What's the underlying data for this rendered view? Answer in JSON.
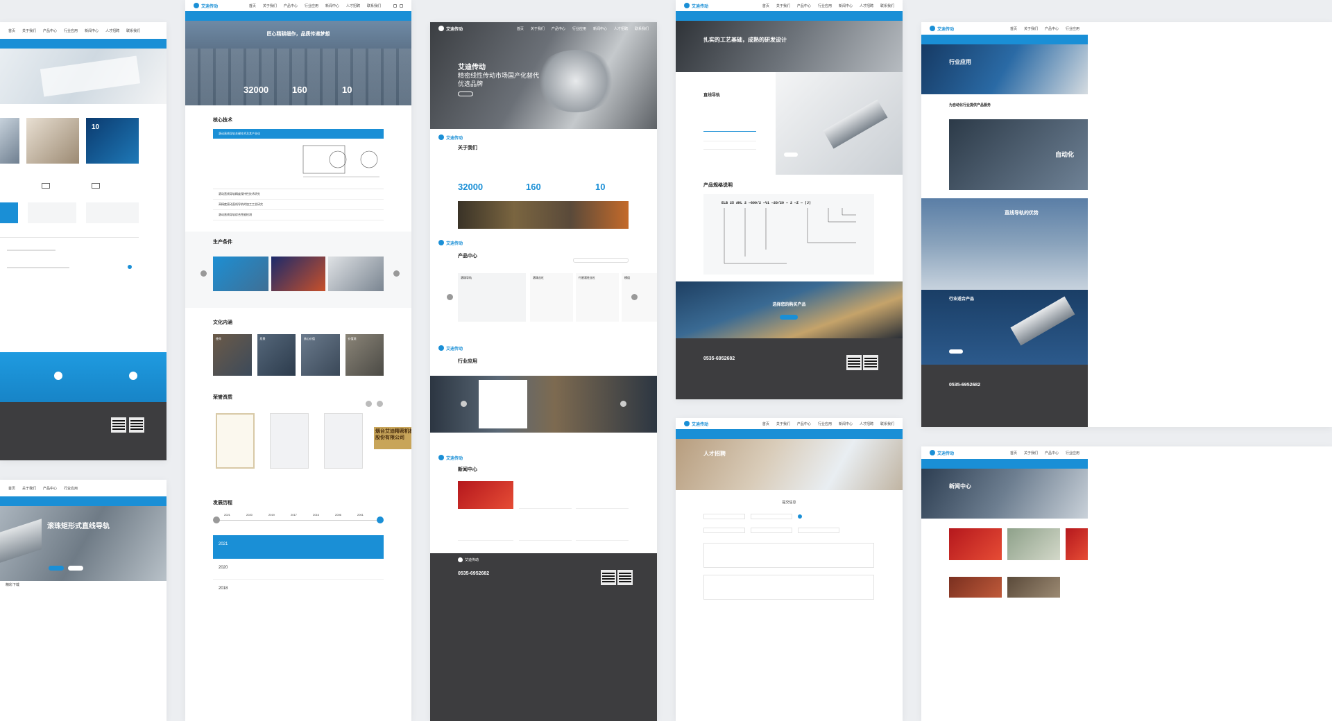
{
  "nav": {
    "brand": "艾迪传动",
    "items": [
      "首页",
      "关于我们",
      "产品中心",
      "行业应用",
      "新闻中心",
      "人才招聘",
      "联系我们"
    ]
  },
  "panel1": {
    "big_card_num": "10",
    "solutions_label": "解决方案"
  },
  "panel2": {
    "hero_title": "匠心精耕细作，品质传递梦想",
    "stat1": "32000",
    "stat2": "160",
    "stat3": "10",
    "core_title": "核心技术",
    "core_bar": "滚动直线导轨关键技术及其产业化",
    "core_items": [
      "滚动直线导轨精度保持性技术研究",
      "高精度滚动直线导轨的加工工艺研究",
      "滚动直线导轨综合性能检测"
    ],
    "prod_title": "生产条件",
    "culture_title": "文化内涵",
    "culture_items": [
      "使命",
      "愿景",
      "核心价值",
      "价值观"
    ],
    "honor_title": "荣誉资质",
    "honor_sign": "烟台艾迪精密机械股份有限公司",
    "history_title": "发展历程",
    "history_years": [
      "2021",
      "2020",
      "2019",
      "2017",
      "2016",
      "2006",
      "2001"
    ],
    "history_rows": [
      "2021",
      "2020",
      "2018"
    ]
  },
  "panel3": {
    "hero_brand": "艾迪传动",
    "hero_line1": "精密线性传动市场国产化替代",
    "hero_line2": "优选品牌",
    "about_title": "关于我们",
    "stat1": "32000",
    "stat2": "160",
    "stat3": "10",
    "product_title": "产品中心",
    "products": [
      "滚珠导轨",
      "滚珠丝杠",
      "行星滚柱丝杠",
      "模组"
    ],
    "industry_title": "行业应用",
    "news_title": "新闻中心",
    "phone": "0535-6952682"
  },
  "panel4": {
    "hero_title": "扎实的工艺基础，成熟的研发设计",
    "product_name": "直线导轨",
    "spec_title": "产品规格说明",
    "spec_code": "ELB 25 AHL 2 —600/2 —V1 —20/20 — 2 —Z — (J)",
    "cta": "选择您的购买产品",
    "phone": "0535-6952682"
  },
  "panel5": {
    "hero_title": "行业应用",
    "sub_title": "为自动化行业提供产品服务",
    "auto_label": "自动化",
    "adv_label": "直线导轨的优势",
    "fit_label": "行业适合产品",
    "phone": "0535-6952682",
    "news_title": "新闻中心"
  },
  "panel6": {
    "hero_title": "滚珠矩形式直线导轨",
    "footer_link": "精彩下载"
  },
  "panel7": {
    "hero_title": "人才招聘",
    "form_title": "提交信息"
  }
}
